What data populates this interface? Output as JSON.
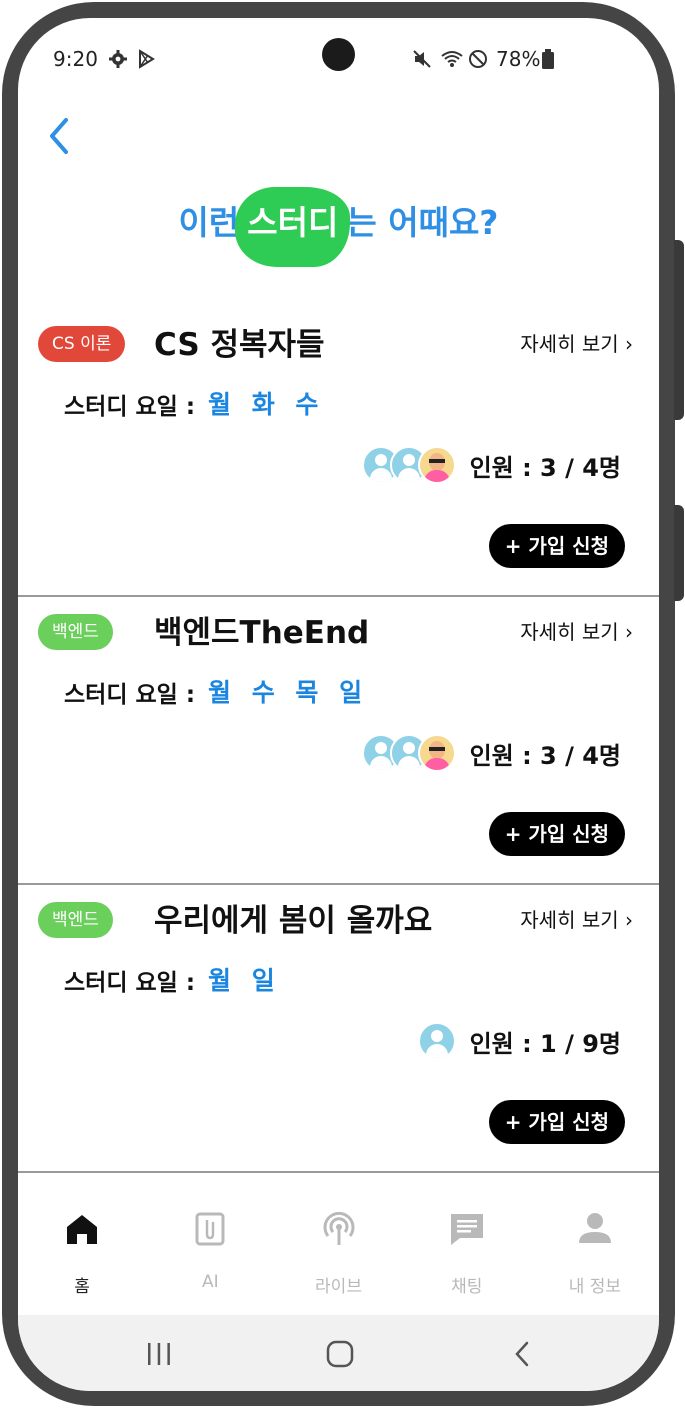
{
  "status_bar": {
    "time": "9:20",
    "battery": "78%"
  },
  "heading": {
    "before": "이런",
    "highlight": "스터디",
    "after": "는 어때요?"
  },
  "colors": {
    "accent_blue": "#2f8fe4",
    "highlight_green": "#2ecc55",
    "badge_red": "#e2483a",
    "badge_green": "#6bcf5c"
  },
  "studies": [
    {
      "badge": "CS 이론",
      "badge_color": "#e2483a",
      "title": "CS 정복자들",
      "detail": "자세히 보기 ›",
      "days_label": "스터디 요일 :",
      "days": "월 화 수",
      "members": "인원 :  3 / 4명",
      "join": "+ 가입 신청"
    },
    {
      "badge": "백엔드",
      "badge_color": "#6bcf5c",
      "title": "백엔드TheEnd",
      "detail": "자세히 보기 ›",
      "days_label": "스터디 요일 :",
      "days": "월 수 목 일",
      "members": "인원 :  3 / 4명",
      "join": "+ 가입 신청"
    },
    {
      "badge": "백엔드",
      "badge_color": "#6bcf5c",
      "title": "우리에게 봄이 올까요",
      "detail": "자세히 보기 ›",
      "days_label": "스터디 요일 :",
      "days": "월 일",
      "members": "인원 :  1 / 9명",
      "join": "+ 가입 신청"
    }
  ],
  "bottom_nav": [
    {
      "label": "홈",
      "icon": "home-icon",
      "active": true
    },
    {
      "label": "AI",
      "icon": "document-icon",
      "active": false
    },
    {
      "label": "라이브",
      "icon": "broadcast-icon",
      "active": false
    },
    {
      "label": "채팅",
      "icon": "chat-icon",
      "active": false
    },
    {
      "label": "내 정보",
      "icon": "user-icon",
      "active": false
    }
  ]
}
